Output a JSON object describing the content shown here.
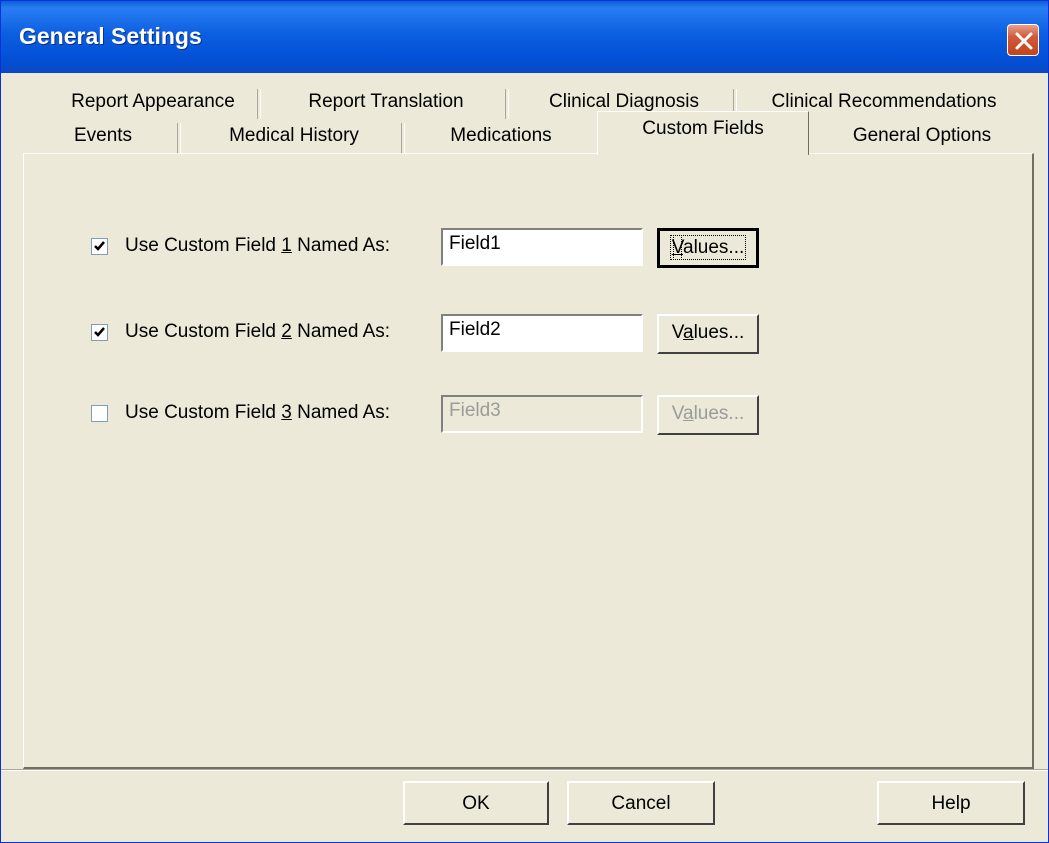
{
  "window": {
    "title": "General Settings"
  },
  "tabs_row1": [
    {
      "label": "Report Appearance"
    },
    {
      "label": "Report Translation"
    },
    {
      "label": "Clinical Diagnosis"
    },
    {
      "label": "Clinical Recommendations"
    }
  ],
  "tabs_row2": [
    {
      "label": "Events"
    },
    {
      "label": "Medical History"
    },
    {
      "label": "Medications"
    },
    {
      "label": "Custom Fields",
      "active": true
    },
    {
      "label": "General Options"
    }
  ],
  "custom_fields": [
    {
      "label_pre": "Use Custom Field ",
      "label_key": "1",
      "label_post": " Named As:",
      "checked": true,
      "value": "Field1",
      "values_pre": "",
      "values_key": "V",
      "values_post": "alues...",
      "enabled": true
    },
    {
      "label_pre": "Use Custom Field ",
      "label_key": "2",
      "label_post": " Named As:",
      "checked": true,
      "value": "Field2",
      "values_pre": "V",
      "values_key": "a",
      "values_post": "lues...",
      "enabled": true
    },
    {
      "label_pre": "Use Custom Field ",
      "label_key": "3",
      "label_post": " Named As:",
      "checked": false,
      "value": "Field3",
      "values_pre": "V",
      "values_key": "a",
      "values_post": "lues...",
      "enabled": false
    }
  ],
  "buttons": {
    "ok": "OK",
    "cancel": "Cancel",
    "help": "Help"
  }
}
